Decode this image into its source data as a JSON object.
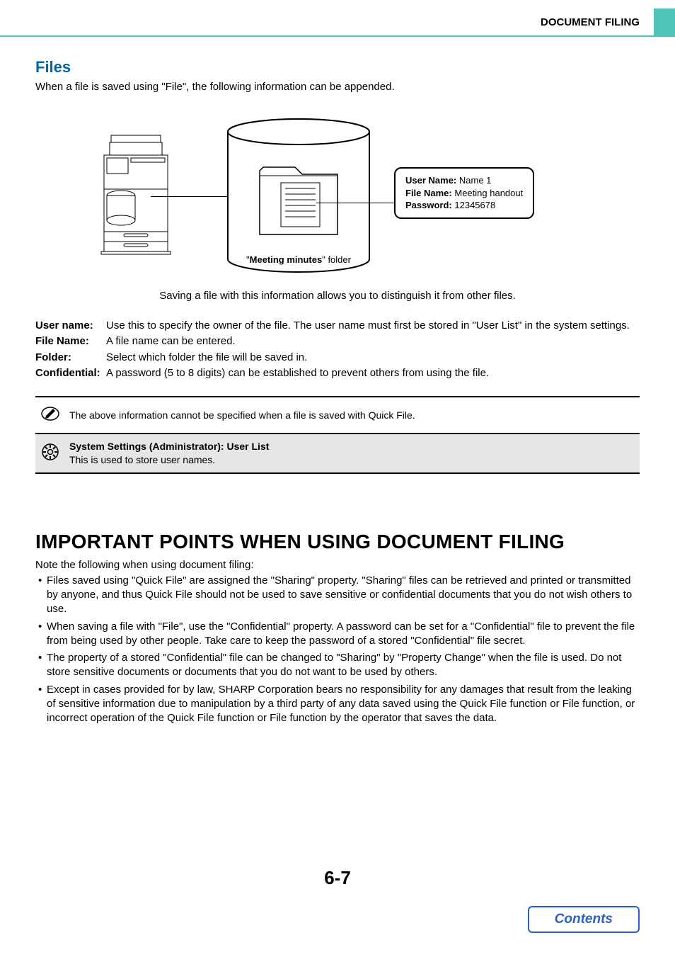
{
  "header": {
    "title": "DOCUMENT FILING"
  },
  "files": {
    "heading": "Files",
    "intro": "When a file is saved using \"File\", the following information can be appended."
  },
  "diagram": {
    "callout": {
      "userNameLabel": "User Name:",
      "userNameValue": "Name 1",
      "fileNameLabel": "File Name:",
      "fileNameValue": "Meeting handout",
      "passwordLabel": "Password:",
      "passwordValue": "12345678"
    },
    "folderLabel": {
      "prefix": "\"",
      "name": "Meeting minutes",
      "suffix": "\" folder"
    }
  },
  "caption": "Saving a file with this information allows you to distinguish it from other files.",
  "definitions": [
    {
      "term": "User name:",
      "desc": "Use this to specify the owner of the file. The user name must first be stored in \"User List\" in the system settings."
    },
    {
      "term": "File Name:",
      "desc": "A file name can be entered."
    },
    {
      "term": "Folder:",
      "desc": "Select which folder the file will be saved in."
    },
    {
      "term": "Confidential:",
      "desc": "A password (5 to 8 digits) can be established to prevent others from using the file."
    }
  ],
  "noteBox": "The above information cannot be specified when a file is saved with Quick File.",
  "settingsBox": {
    "title": "System Settings (Administrator): User List",
    "body": "This is used to store user names."
  },
  "important": {
    "heading": "IMPORTANT POINTS WHEN USING DOCUMENT FILING",
    "intro": "Note the following when using document filing:",
    "bullets": [
      "Files saved using \"Quick File\" are assigned the \"Sharing\" property. \"Sharing\" files can be retrieved and printed or transmitted by anyone, and thus Quick File should not be used to save sensitive or confidential documents that you do not wish others to use.",
      "When saving a file with \"File\", use the \"Confidential\" property. A password can be set for a \"Confidential\" file to prevent the file from being used by other people. Take care to keep the password of a stored \"Confidential\" file secret.",
      "The property of a stored \"Confidential\" file can be changed to \"Sharing\" by \"Property Change\" when the file is used. Do not store sensitive documents or documents that you do not want to be used by others.",
      "Except in cases provided for by law, SHARP Corporation bears no responsibility for any damages that result from the leaking of sensitive information due to manipulation by a third party of any data saved using the Quick File function or File function, or incorrect operation of the Quick File function or File function by the operator that saves the data."
    ]
  },
  "pageNumber": "6-7",
  "contentsButton": "Contents"
}
